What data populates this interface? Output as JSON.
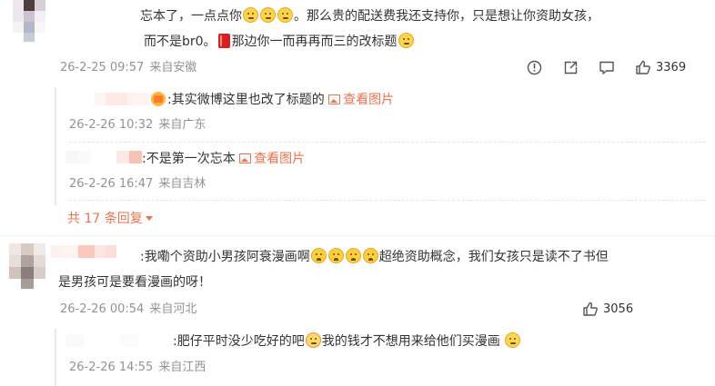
{
  "comments": [
    {
      "text_line1_a": "忘本了，一点点你",
      "text_line1_b": "。那么贵的配送费我还支持你，只是想让你资助女孩，",
      "text_line2_a": "而不是br0。",
      "text_line2_b": "那边你一而再再而三的改标题",
      "time": "26-2-25 09:57",
      "location": "来自安徽",
      "likes": "3369",
      "emoji_1": "doge-emoji",
      "emoji_2": "book-icon",
      "replies": [
        {
          "text": ":其实微博这里也改了标题的",
          "view_image": "查看图片",
          "time": "26-2-26 10:32",
          "location": "来自广东"
        },
        {
          "text": ":不是第一次忘本",
          "view_image": "查看图片",
          "time": "26-2-26 16:47",
          "location": "来自吉林"
        }
      ],
      "more_replies": "共 17 条回复"
    },
    {
      "text_line1_a": ":我嘞个资助小男孩阿衰漫画啊",
      "text_line1_b": "超绝资助概念，我们女孩只是读不了书但",
      "text_line2": "是男孩可是要看漫画的呀！",
      "time": "26-2-26 00:54",
      "location": "来自河北",
      "likes": "3056",
      "emoji_1": "cry-emoji",
      "replies": [
        {
          "text_a": ":肥仔平时没少吃好的吧",
          "text_b": "我的钱才不想用来给他们买漫画",
          "time": "26-2-26 14:55",
          "location": "来自江西"
        }
      ]
    }
  ],
  "icons": {
    "report": "report-icon",
    "share": "share-icon",
    "comment": "comment-icon",
    "like": "thumbs-up-icon",
    "accent": "#eb7350",
    "meta_gray": "#939393"
  }
}
